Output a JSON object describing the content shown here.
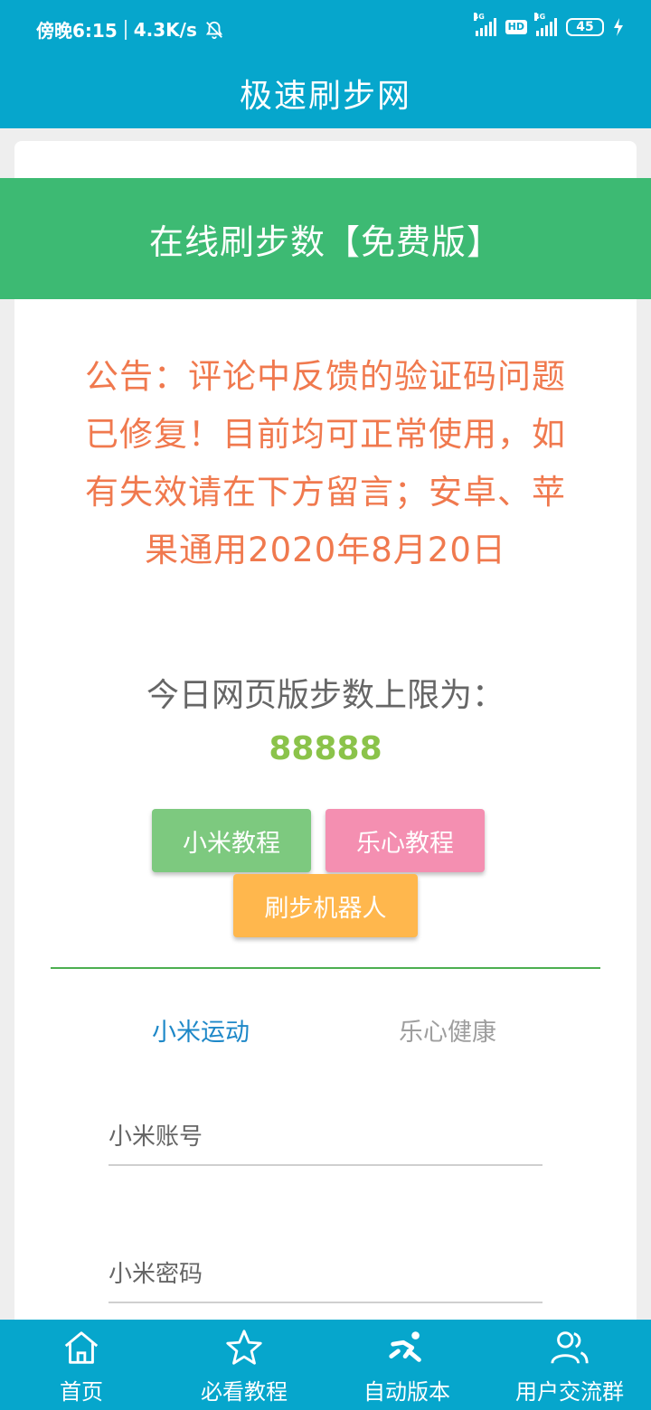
{
  "status_bar": {
    "time": "傍晚6:15",
    "speed": "4.3K/s",
    "battery": "45",
    "network_label_1": "4G",
    "network_label_2": "4G",
    "hd": "HD"
  },
  "app_bar": {
    "title": "极速刷步网"
  },
  "banner": {
    "title": "在线刷步数【免费版】"
  },
  "announcement": {
    "text": "公告：评论中反馈的验证码问题已修复！目前均可正常使用，如有失效请在下方留言；安卓、苹果通用2020年8月20日"
  },
  "limit": {
    "label": "今日网页版步数上限为：",
    "value": "88888"
  },
  "buttons": {
    "xiaomi_tutorial": "小米教程",
    "lexin_tutorial": "乐心教程",
    "robot": "刷步机器人"
  },
  "tabs": [
    {
      "label": "小米运动",
      "active": true
    },
    {
      "label": "乐心健康",
      "active": false
    }
  ],
  "form": {
    "account_placeholder": "小米账号",
    "password_placeholder": "小米密码"
  },
  "bottom_nav": [
    {
      "label": "首页",
      "icon": "home-icon"
    },
    {
      "label": "必看教程",
      "icon": "star-icon"
    },
    {
      "label": "自动版本",
      "icon": "runner-icon"
    },
    {
      "label": "用户交流群",
      "icon": "users-icon"
    }
  ],
  "colors": {
    "primary": "#06a6cc",
    "banner_green": "#3dba73",
    "announcement_orange": "#f0794e",
    "limit_value_green": "#8bc34a",
    "tab_active_blue": "#1e88c8"
  }
}
